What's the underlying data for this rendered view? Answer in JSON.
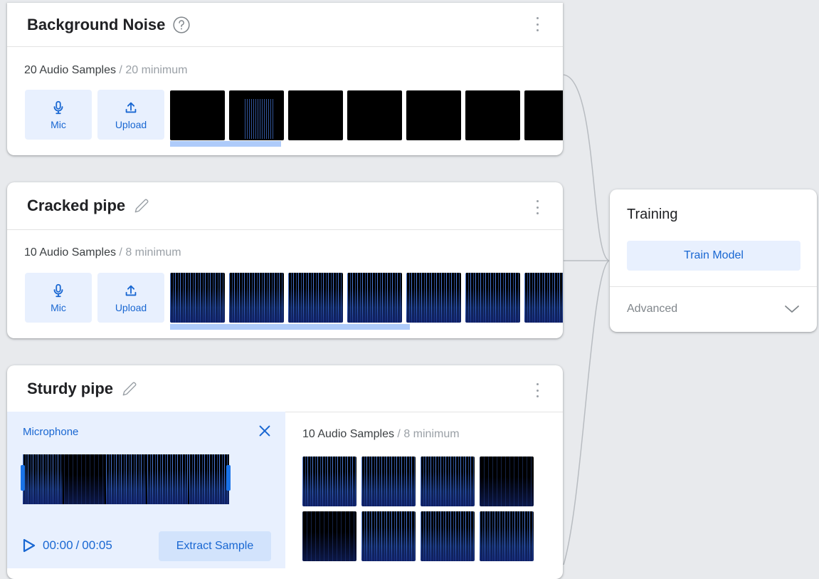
{
  "classes": [
    {
      "title": "Background Noise",
      "title_icon": "help-circle-icon",
      "samples_count": "20 Audio Samples",
      "minimum": " / 20 minimum",
      "mic_label": "Mic",
      "upload_label": "Upload",
      "progress_fraction": 0.2
    },
    {
      "title": "Cracked pipe",
      "title_icon": "pencil-icon",
      "samples_count": "10 Audio Samples",
      "minimum": " / 8 minimum",
      "mic_label": "Mic",
      "upload_label": "Upload",
      "progress_fraction": 0.44
    },
    {
      "title": "Sturdy pipe",
      "title_icon": "pencil-icon",
      "samples_count": "10 Audio Samples",
      "minimum": " / 8 minimum",
      "microphone_panel": {
        "label": "Microphone",
        "current_time": "00:00",
        "separator": "/",
        "total_time": "00:05",
        "extract_label": "Extract Sample"
      }
    }
  ],
  "training": {
    "title": "Training",
    "train_button": "Train Model",
    "advanced_label": "Advanced"
  },
  "colors": {
    "accent": "#1967d2",
    "button_bg": "#e8f0fe",
    "progress": "#aecbfa",
    "background": "#e8eaed"
  }
}
